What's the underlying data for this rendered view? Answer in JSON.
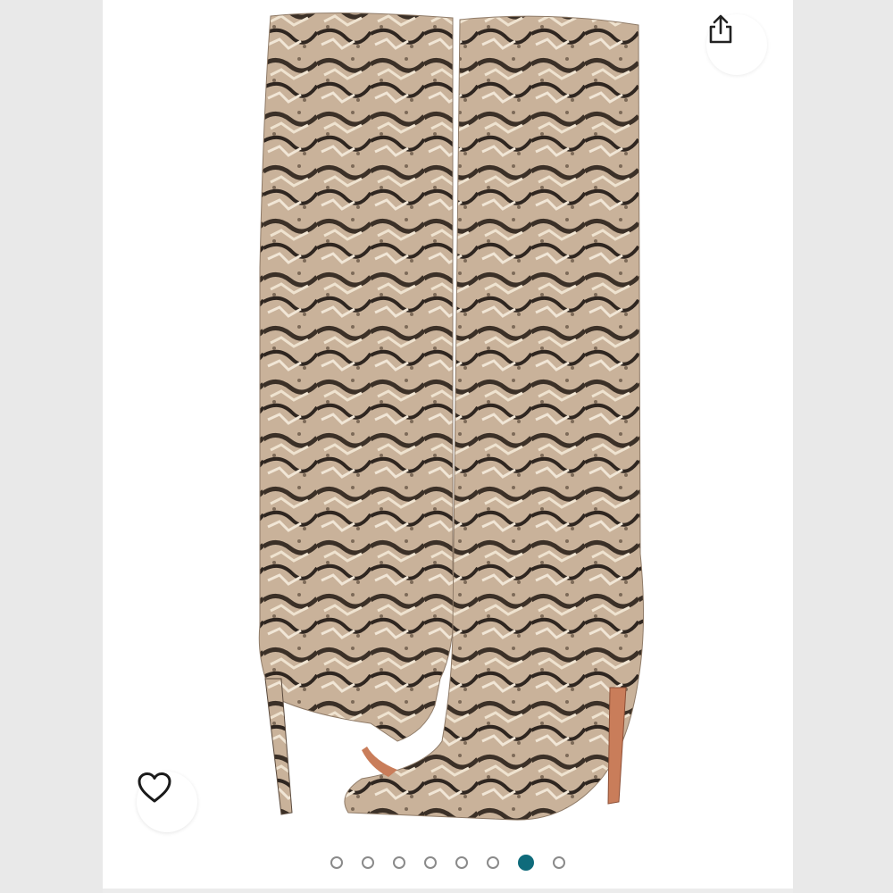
{
  "gallery": {
    "image_subject": "snakeskin-knee-high-stiletto-boots",
    "total_images": 8,
    "active_index": 6,
    "colors": {
      "active_dot": "#0f6b7b",
      "inactive_dot_border": "#8a8a8a",
      "background": "#ffffff"
    }
  },
  "actions": {
    "share_icon": "share-icon",
    "like_icon": "heart-outline-icon"
  }
}
